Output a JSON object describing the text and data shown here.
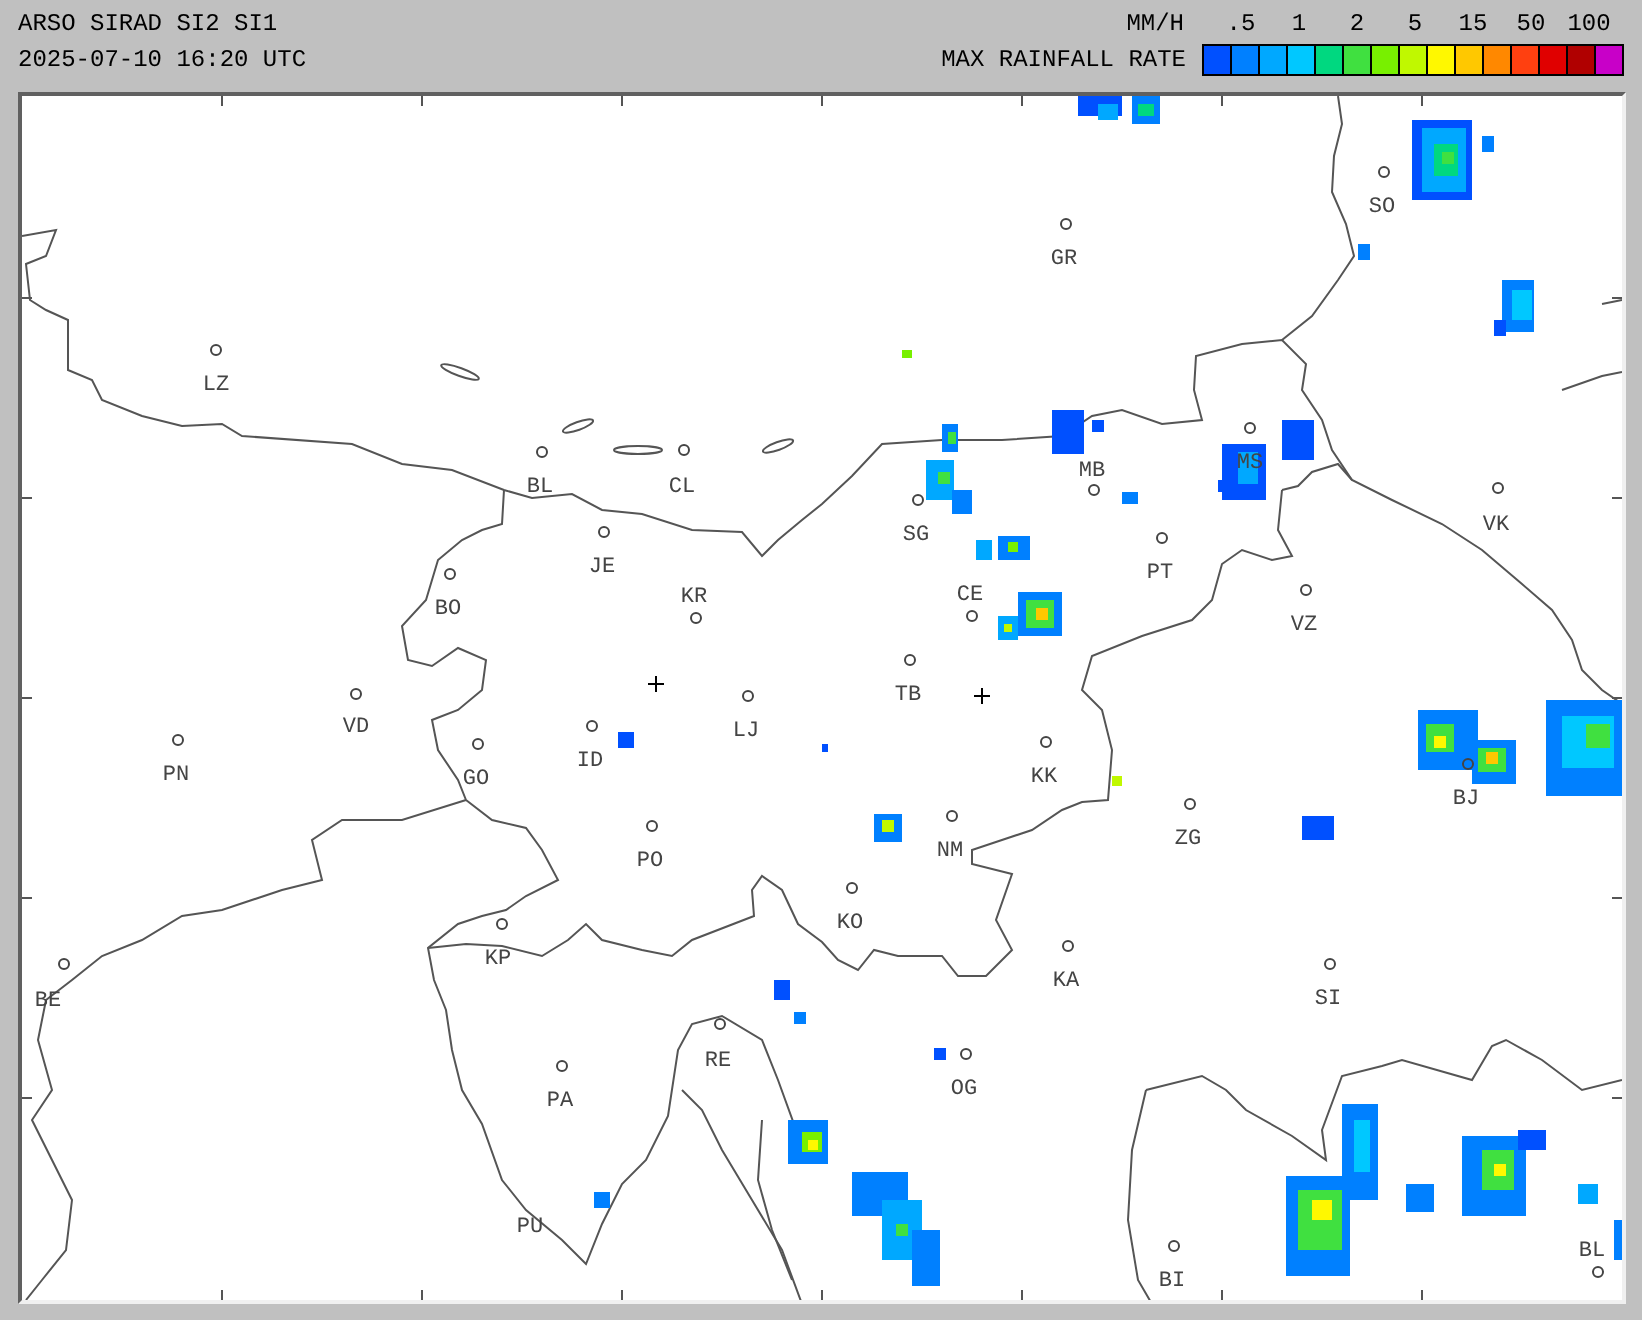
{
  "header": {
    "title": "ARSO SIRAD SI2 SI1",
    "timestamp": "2025-07-10 16:20 UTC"
  },
  "legend": {
    "unit": "MM/H",
    "title": "MAX RAINFALL RATE",
    "ticks": [
      ".5",
      "1",
      "2",
      "5",
      "15",
      "50",
      "100"
    ],
    "cells": [
      {
        "color": "#0050ff"
      },
      {
        "color": "#0080ff"
      },
      {
        "color": "#00a8ff"
      },
      {
        "color": "#00c8ff"
      },
      {
        "color": "#00d880"
      },
      {
        "color": "#40e040"
      },
      {
        "color": "#78f000"
      },
      {
        "color": "#c0f800"
      },
      {
        "color": "#fff800"
      },
      {
        "color": "#ffc800"
      },
      {
        "color": "#ff8800"
      },
      {
        "color": "#ff4010"
      },
      {
        "color": "#e00000"
      },
      {
        "color": "#b00000"
      },
      {
        "color": "#c800c8"
      }
    ]
  },
  "map": {
    "places": [
      {
        "label": "SO",
        "marker": true
      },
      {
        "label": "GR",
        "marker": true
      },
      {
        "label": "LZ",
        "marker": true
      },
      {
        "label": "MS",
        "marker": true
      },
      {
        "label": "BL",
        "marker": true
      },
      {
        "label": "CL",
        "marker": true
      },
      {
        "label": "MB",
        "marker": true
      },
      {
        "label": "SG",
        "marker": true
      },
      {
        "label": "VK",
        "marker": true
      },
      {
        "label": "JE",
        "marker": true
      },
      {
        "label": "PT",
        "marker": true
      },
      {
        "label": "BO",
        "marker": true
      },
      {
        "label": "KR",
        "marker": true
      },
      {
        "label": "CE",
        "marker": true
      },
      {
        "label": "VZ",
        "marker": true
      },
      {
        "label": "TB",
        "marker": true
      },
      {
        "label": "VD",
        "marker": true
      },
      {
        "label": "LJ",
        "marker": true
      },
      {
        "label": "PN",
        "marker": true
      },
      {
        "label": "ID",
        "marker": true
      },
      {
        "label": "GO",
        "marker": true
      },
      {
        "label": "KK",
        "marker": true
      },
      {
        "label": "BJ",
        "marker": true
      },
      {
        "label": "ZG",
        "marker": true
      },
      {
        "label": "NM",
        "marker": true
      },
      {
        "label": "PO",
        "marker": true
      },
      {
        "label": "KO",
        "marker": true
      },
      {
        "label": "KP",
        "marker": true
      },
      {
        "label": "KA",
        "marker": true
      },
      {
        "label": "BE",
        "marker": true
      },
      {
        "label": "SI",
        "marker": true
      },
      {
        "label": "RE",
        "marker": true
      },
      {
        "label": "OG",
        "marker": true
      },
      {
        "label": "PA",
        "marker": true
      },
      {
        "label": "PU",
        "marker": false
      },
      {
        "label": "BI",
        "marker": true
      },
      {
        "label": "BL",
        "marker": true
      }
    ]
  }
}
